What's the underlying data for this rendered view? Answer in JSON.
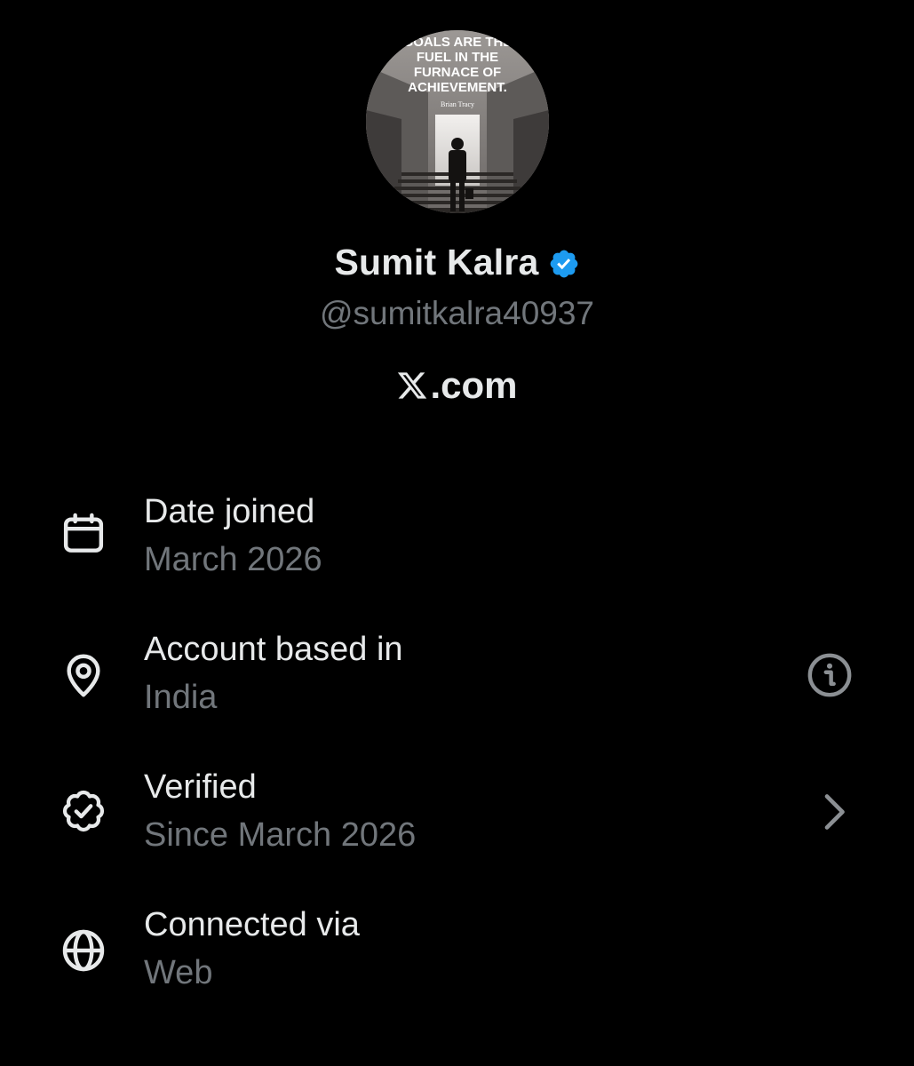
{
  "profile": {
    "avatar_quote": [
      "GOALS ARE THE",
      "FUEL IN THE",
      "FURNACE OF",
      "ACHIEVEMENT."
    ],
    "avatar_quote_author": "Brian Tracy",
    "display_name": "Sumit Kalra",
    "handle": "@sumitkalra40937",
    "site": ".com",
    "verified_badge_color": "#1d9bf0"
  },
  "info": {
    "date_joined": {
      "label": "Date joined",
      "value": "March 2026",
      "icon": "calendar-icon"
    },
    "account_based_in": {
      "label": "Account based in",
      "value": "India",
      "icon": "location-pin-icon",
      "action_icon": "info-icon"
    },
    "verified": {
      "label": "Verified",
      "value": "Since March 2026",
      "icon": "verified-outline-icon",
      "action_icon": "chevron-right-icon"
    },
    "connected_via": {
      "label": "Connected via",
      "value": "Web",
      "icon": "globe-icon"
    }
  },
  "colors": {
    "background": "#000000",
    "primary_text": "#e7e9ea",
    "secondary_text": "#71767b",
    "accent": "#1d9bf0"
  }
}
